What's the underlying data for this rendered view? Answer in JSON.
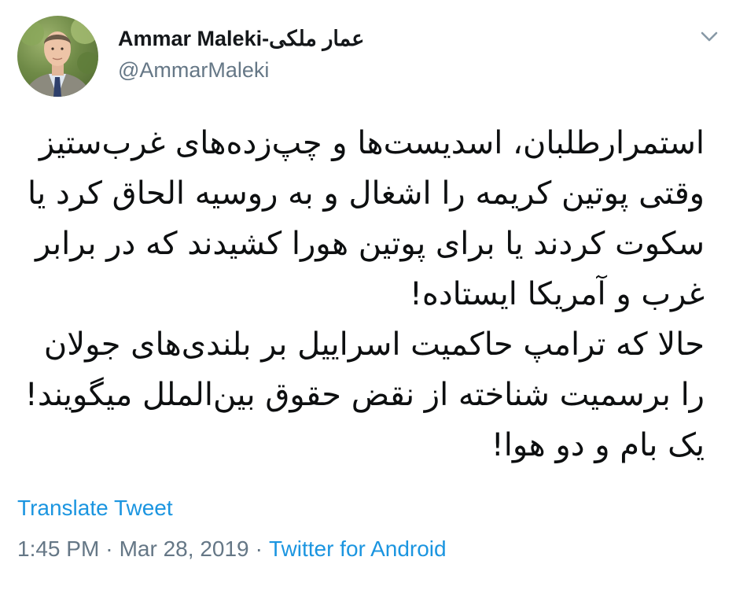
{
  "tweet": {
    "author": {
      "display_name": "Ammar Maleki-عمار ملکی",
      "handle": "@AmmarMaleki"
    },
    "text_lines": [
      "استمرارطلبان، اسدیست‌ها و چپ‌زده‌های غرب‌ستیز",
      "وقتی پوتین کریمه را اشغال و به روسیه الحاق کرد یا",
      "سکوت کردند یا برای پوتین هورا کشیدند که در برابر",
      "غرب و آمریکا ایستاده!",
      "حالا که ترامپ حاکمیت اسراییل بر بلندی‌های جولان",
      "را برسمیت شناخته از نقض حقوق بین‌الملل میگویند!",
      "یک بام و دو هوا!"
    ],
    "translate_label": "Translate Tweet",
    "time": "1:45 PM",
    "separator": "·",
    "date": "Mar 28, 2019",
    "source": "Twitter for Android"
  },
  "icons": {
    "menu": "chevron-down-icon",
    "avatar": "profile-photo"
  },
  "colors": {
    "link": "#1b95e0",
    "secondary_text": "#657786",
    "primary_text": "#14171a"
  }
}
